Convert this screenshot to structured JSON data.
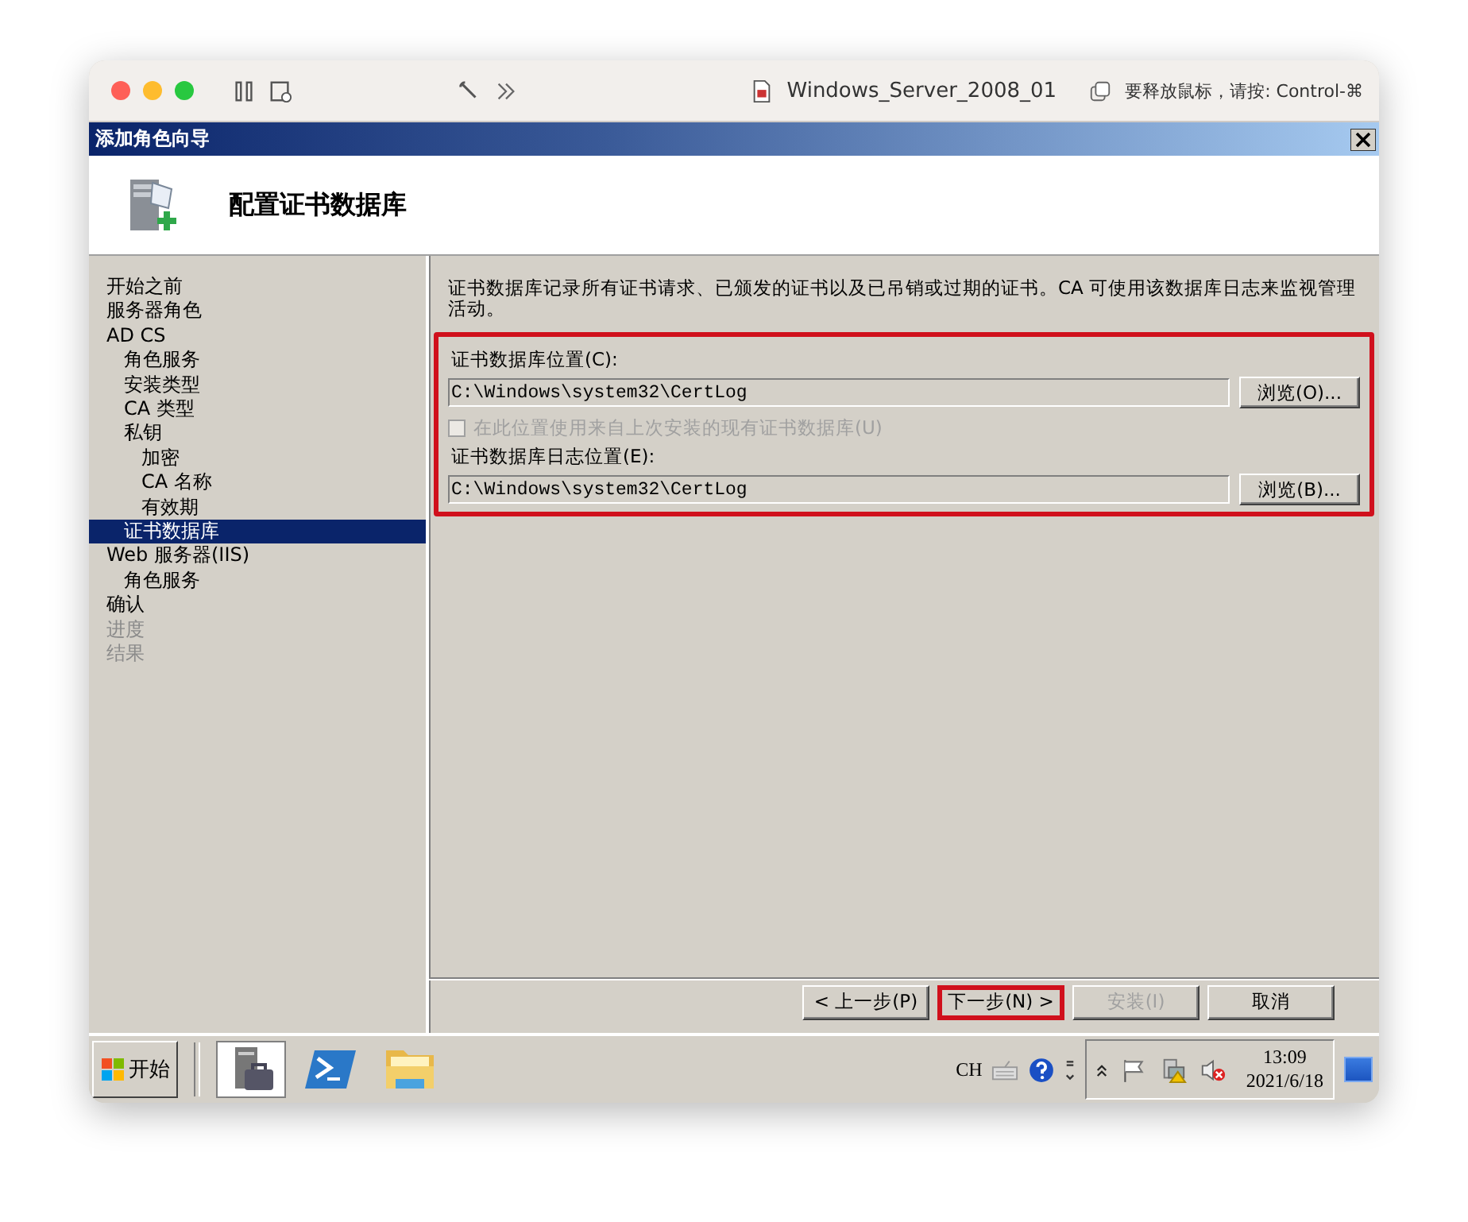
{
  "host_window": {
    "title": "Windows_Server_2008_01",
    "hint": "要释放鼠标，请按: Control-⌘"
  },
  "wizard": {
    "title": "添加角色向导",
    "heading": "配置证书数据库"
  },
  "steps": [
    {
      "label": "开始之前",
      "selected": false,
      "disabled": false
    },
    {
      "label": "服务器角色",
      "selected": false,
      "disabled": false
    },
    {
      "label": "AD CS",
      "selected": false,
      "disabled": false,
      "children": [
        {
          "label": "角色服务",
          "selected": false,
          "disabled": false
        },
        {
          "label": "安装类型",
          "selected": false,
          "disabled": false
        },
        {
          "label": "CA 类型",
          "selected": false,
          "disabled": false
        },
        {
          "label": "私钥",
          "selected": false,
          "disabled": false,
          "children": [
            {
              "label": "加密",
              "selected": false,
              "disabled": false
            },
            {
              "label": "CA 名称",
              "selected": false,
              "disabled": false
            },
            {
              "label": "有效期",
              "selected": false,
              "disabled": false
            }
          ]
        },
        {
          "label": "证书数据库",
          "selected": true,
          "disabled": false
        }
      ]
    },
    {
      "label": "Web 服务器(IIS)",
      "selected": false,
      "disabled": false,
      "children": [
        {
          "label": "角色服务",
          "selected": false,
          "disabled": false
        }
      ]
    },
    {
      "label": "确认",
      "selected": false,
      "disabled": false
    },
    {
      "label": "进度",
      "selected": false,
      "disabled": true
    },
    {
      "label": "结果",
      "selected": false,
      "disabled": true
    }
  ],
  "description": "证书数据库记录所有证书请求、已颁发的证书以及已吊销或过期的证书。CA 可使用该数据库日志来监视管理活动。",
  "form": {
    "highlighted": true,
    "controls": [
      {
        "kind": "field",
        "label": "证书数据库位置(C):",
        "value": "C:\\Windows\\system32\\CertLog",
        "browse": "浏览(O)..."
      },
      {
        "kind": "checkbox",
        "label": "在此位置使用来自上次安装的现有证书数据库(U)",
        "checked": false,
        "disabled": true
      },
      {
        "kind": "field",
        "label": "证书数据库日志位置(E):",
        "value": "C:\\Windows\\system32\\CertLog",
        "browse": "浏览(B)..."
      }
    ]
  },
  "buttons": [
    {
      "label": "< 上一步(P)",
      "disabled": false,
      "highlighted": false
    },
    {
      "label": "下一步(N) >",
      "disabled": false,
      "highlighted": true
    },
    {
      "label": "安装(I)",
      "disabled": true,
      "highlighted": false
    },
    {
      "label": "取消",
      "disabled": false,
      "highlighted": false
    }
  ],
  "taskbar": {
    "start": "开始",
    "apps": [
      {
        "kind": "server",
        "selected": true
      },
      {
        "kind": "powershell",
        "selected": false
      },
      {
        "kind": "folder",
        "selected": false
      }
    ],
    "input_language": "CH",
    "time": "13:09",
    "date": "2021/6/18"
  }
}
